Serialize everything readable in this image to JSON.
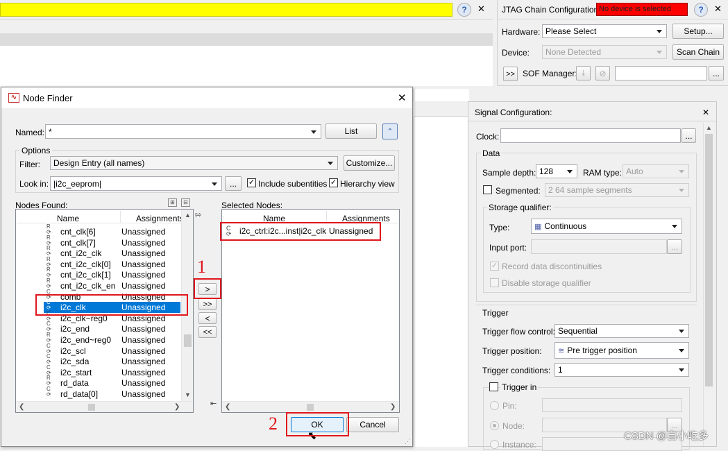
{
  "top_bar": {
    "help_glyph": "?",
    "close_glyph": "✕"
  },
  "jtag": {
    "title": "JTAG Chain Configuration:",
    "status": "No device is selected",
    "help_glyph": "?",
    "close_glyph": "✕",
    "hardware_label": "Hardware:",
    "hardware_value": "Please Select",
    "setup_label": "Setup...",
    "device_label": "Device:",
    "device_value": "None Detected",
    "scan_chain_label": "Scan Chain",
    "expand_label": ">>",
    "sof_label": "SOF Manager:",
    "browse_label": "..."
  },
  "node_finder": {
    "title": "Node Finder",
    "close_glyph": "✕",
    "named_label": "Named:",
    "named_value": "*",
    "list_button": "List",
    "options_label": "Options",
    "filter_label": "Filter:",
    "filter_value": "Design Entry (all names)",
    "customize_button": "Customize...",
    "lookin_label": "Look in:",
    "lookin_value": "|i2c_eeprom|",
    "browse_label": "...",
    "include_subentities_label": "Include subentities",
    "include_subentities_checked": true,
    "hierarchy_view_label": "Hierarchy view",
    "hierarchy_view_checked": true,
    "nodes_found_label": "Nodes Found:",
    "col_name": "Name",
    "col_assignments": "Assignments",
    "nodes": [
      {
        "prefix": "R",
        "name": "cnt_clk[6]",
        "assign": "Unassigned"
      },
      {
        "prefix": "R",
        "name": "cnt_clk[7]",
        "assign": "Unassigned"
      },
      {
        "prefix": "R",
        "name": "cnt_i2c_clk",
        "assign": "Unassigned"
      },
      {
        "prefix": "R",
        "name": "cnt_i2c_clk[0]",
        "assign": "Unassigned"
      },
      {
        "prefix": "R",
        "name": "cnt_i2c_clk[1]",
        "assign": "Unassigned"
      },
      {
        "prefix": "R",
        "name": "cnt_i2c_clk_en",
        "assign": "Unassigned"
      },
      {
        "prefix": "C",
        "name": "comb",
        "assign": "Unassigned"
      },
      {
        "prefix": "C",
        "name": "i2c_clk",
        "assign": "Unassigned"
      },
      {
        "prefix": "C",
        "name": "i2c_clk~reg0",
        "assign": "Unassigned"
      },
      {
        "prefix": "C",
        "name": "i2c_end",
        "assign": "Unassigned"
      },
      {
        "prefix": "R",
        "name": "i2c_end~reg0",
        "assign": "Unassigned"
      },
      {
        "prefix": "C",
        "name": "i2c_scl",
        "assign": "Unassigned"
      },
      {
        "prefix": "C",
        "name": "i2c_sda",
        "assign": "Unassigned"
      },
      {
        "prefix": "C",
        "name": "i2c_start",
        "assign": "Unassigned"
      },
      {
        "prefix": "R",
        "name": "rd_data",
        "assign": "Unassigned"
      },
      {
        "prefix": "C",
        "name": "rd_data[0]",
        "assign": "Unassigned"
      }
    ],
    "selected_row_index": 7,
    "selected_nodes_label": "Selected Nodes:",
    "selected_nodes": [
      {
        "name": "i2c_ctrl:i2c...inst|i2c_clk",
        "assign": "Unassigned"
      }
    ],
    "move_one_right": ">",
    "move_all_right": ">>",
    "move_one_left": "<",
    "move_all_left": "<<",
    "ok_button": "OK",
    "cancel_button": "Cancel",
    "annotation_1": "1",
    "annotation_2": "2"
  },
  "signal_config": {
    "title": "Signal Configuration:",
    "close_glyph": "✕",
    "clock_label": "Clock:",
    "browse_label": "...",
    "data_label": "Data",
    "sample_depth_label": "Sample depth:",
    "sample_depth_value": "128",
    "ram_type_label": "RAM type:",
    "ram_type_value": "Auto",
    "segmented_label": "Segmented:",
    "segmented_value": "2  64 sample segments",
    "storage_qualifier_label": "Storage qualifier:",
    "type_label": "Type:",
    "type_value": "Continuous",
    "input_port_label": "Input port:",
    "record_label": "Record data discontinuities",
    "disable_storage_label": "Disable storage qualifier",
    "trigger_label": "Trigger",
    "trigger_flow_label": "Trigger flow control:",
    "trigger_flow_value": "Sequential",
    "trigger_position_label": "Trigger position:",
    "trigger_position_value": "Pre trigger position",
    "trigger_conditions_label": "Trigger conditions:",
    "trigger_conditions_value": "1",
    "trigger_in_label": "Trigger in",
    "pin_label": "Pin:",
    "node_label": "Node:",
    "instance_label": "Instance:"
  },
  "watermark": "CSDN @自小吃多"
}
